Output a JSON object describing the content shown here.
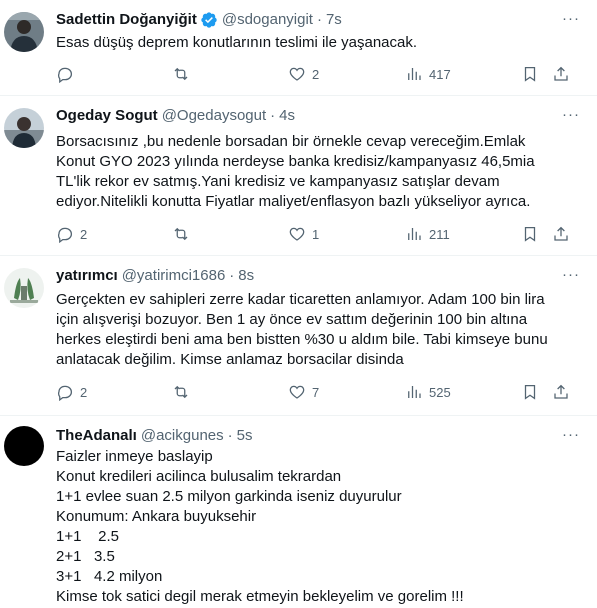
{
  "tweets": [
    {
      "name": "Sadettin Doğanyiğit",
      "verified": true,
      "handle": "@sdoganyigit",
      "time": "7s",
      "lines": [
        "Esas düşüş deprem konutlarının teslimi ile yaşanacak."
      ],
      "replies": "",
      "retweets": "",
      "likes": "2",
      "views": "417",
      "avatar_colors": [
        "#3b4a5a",
        "#8a9aa8"
      ]
    },
    {
      "name": "Ogeday Sogut",
      "verified": false,
      "handle": "@Ogedaysogut",
      "time": "4s",
      "lines": [
        "Borsacısınız ,bu nedenle borsadan bir örnekle cevap vereceğim.Emlak",
        "Konut GYO 2023 yılında nerdeyse banka kredisiz/kampanyasız 46,5mia",
        "TL'lik rekor ev satmış.Yani kredisiz ve kampanyasız satışlar devam",
        "ediyor.Nitelikli konutta Fiyatlar maliyet/enflasyon bazlı yükseliyor ayrıca."
      ],
      "replies": "2",
      "retweets": "",
      "likes": "1",
      "views": "211",
      "avatar_colors": [
        "#5a6b7c",
        "#c9d3dc"
      ]
    },
    {
      "name": "yatırımcı",
      "verified": false,
      "handle": "@yatirimci1686",
      "time": "8s",
      "lines": [
        "Gerçekten ev sahipleri zerre kadar ticaretten anlamıyor. Adam 100 bin lira",
        "için alışverişi bozuyor. Ben 1 ay önce ev sattım değerinin 100 bin altına",
        "herkes eleştirdi beni ama ben bistten %30 u aldım bile. Tabi kimseye bunu",
        "anlatacak değilim. Kimse anlamaz borsacilar disinda"
      ],
      "replies": "2",
      "retweets": "",
      "likes": "7",
      "views": "525",
      "avatar_colors": [
        "#e8eee9",
        "#5c8a5e"
      ]
    },
    {
      "name": "TheAdanalı",
      "verified": false,
      "handle": "@acikgunes",
      "time": "5s",
      "lines": [
        "Faizler inmeye baslayip",
        "Konut kredileri acilinca bulusalim tekrardan",
        "1+1 evlee suan 2.5 milyon garkinda iseniz duyurulur",
        "Konumum: Ankara buyuksehir",
        "1+1    2.5",
        "2+1   3.5",
        "3+1   4.2 milyon",
        "Kimse tok satici degil merak etmeyin bekleyelim ve gorelim !!!"
      ],
      "replies": "",
      "retweets": "",
      "likes": "",
      "views": "",
      "avatar_colors": [
        "#000000",
        "#000000"
      ]
    }
  ],
  "icons": {
    "more": "more-icon",
    "reply": "reply-icon",
    "retweet": "retweet-icon",
    "like": "like-icon",
    "views": "views-icon",
    "bookmark": "bookmark-icon",
    "share": "share-icon",
    "verified": "verified-badge-icon"
  },
  "colors": {
    "text": "#0f1419",
    "secondary": "#536471",
    "verified": "#1d9bf0",
    "divider": "#eff3f4"
  }
}
